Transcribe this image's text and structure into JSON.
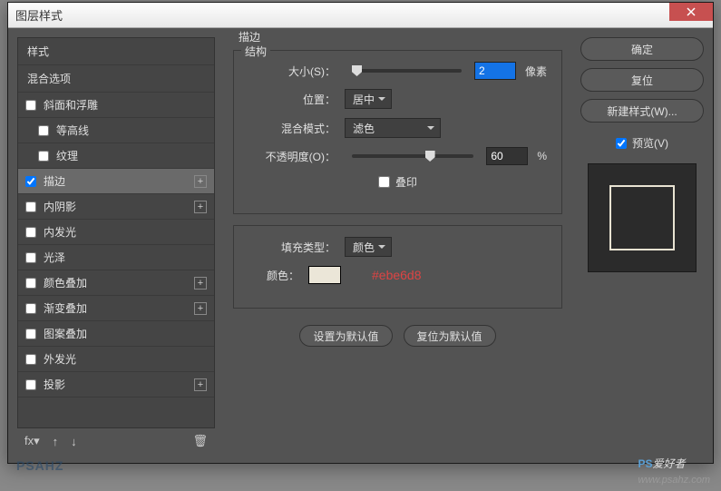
{
  "window": {
    "title": "图层样式"
  },
  "styles": {
    "header": "样式",
    "blending": "混合选项",
    "items": [
      {
        "label": "斜面和浮雕",
        "checked": false,
        "plus": false,
        "sub": false
      },
      {
        "label": "等高线",
        "checked": false,
        "plus": false,
        "sub": true
      },
      {
        "label": "纹理",
        "checked": false,
        "plus": false,
        "sub": true
      },
      {
        "label": "描边",
        "checked": true,
        "plus": true,
        "sub": false,
        "selected": true
      },
      {
        "label": "内阴影",
        "checked": false,
        "plus": true,
        "sub": false
      },
      {
        "label": "内发光",
        "checked": false,
        "plus": false,
        "sub": false
      },
      {
        "label": "光泽",
        "checked": false,
        "plus": false,
        "sub": false
      },
      {
        "label": "颜色叠加",
        "checked": false,
        "plus": true,
        "sub": false
      },
      {
        "label": "渐变叠加",
        "checked": false,
        "plus": true,
        "sub": false
      },
      {
        "label": "图案叠加",
        "checked": false,
        "plus": false,
        "sub": false
      },
      {
        "label": "外发光",
        "checked": false,
        "plus": false,
        "sub": false
      },
      {
        "label": "投影",
        "checked": false,
        "plus": true,
        "sub": false
      }
    ]
  },
  "panel": {
    "groupTitle": "描边",
    "structTitle": "结构",
    "sizeLabel": "大小(S)：",
    "sizeValue": "2",
    "sizeUnit": "像素",
    "posLabel": "位置：",
    "posValue": "居中",
    "blendLabel": "混合模式：",
    "blendValue": "滤色",
    "opacityLabel": "不透明度(O)：",
    "opacityValue": "60",
    "opacityUnit": "%",
    "overprintLabel": "叠印",
    "fillTypeLabel": "填充类型：",
    "fillTypeValue": "颜色",
    "colorLabel": "颜色：",
    "colorHex": "#ebe6d8",
    "setDefault": "设置为默认值",
    "resetDefault": "复位为默认值"
  },
  "buttons": {
    "ok": "确定",
    "reset": "复位",
    "newStyle": "新建样式(W)...",
    "preview": "预览(V)"
  },
  "watermark": {
    "brand": "PS",
    "text": "爱好者",
    "url": "www.psahz.com"
  },
  "logo": "PSAHZ"
}
